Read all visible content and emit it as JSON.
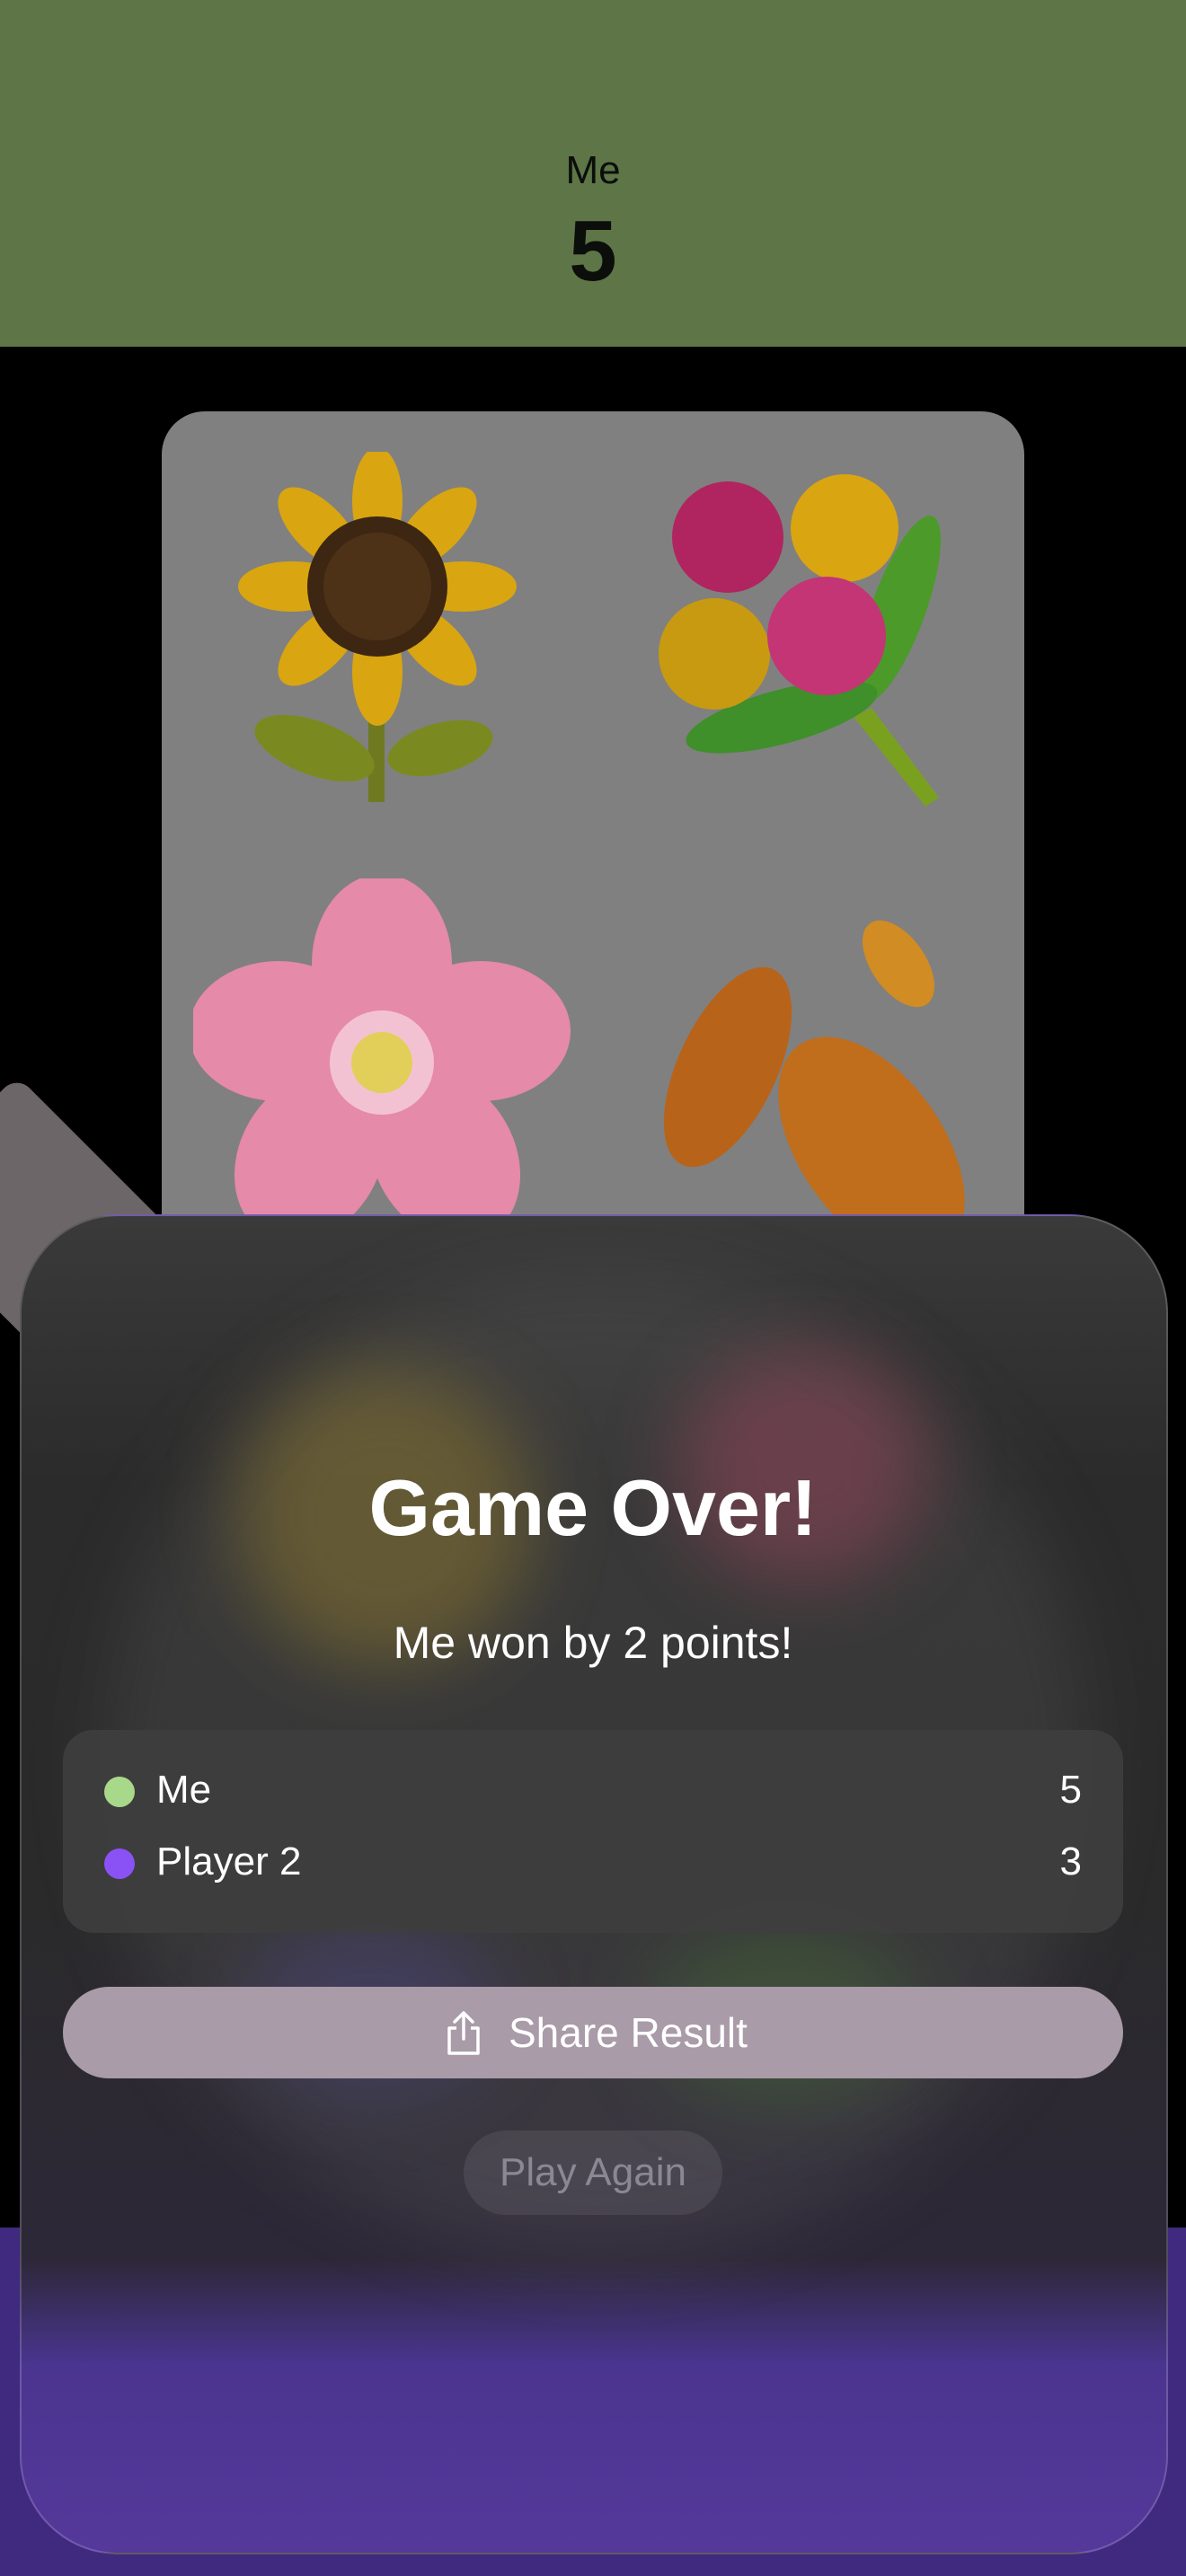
{
  "top_player": {
    "name": "Me",
    "score": "5"
  },
  "card": {
    "items": [
      {
        "icon": "sunflower-icon"
      },
      {
        "icon": "bouquet-icon"
      },
      {
        "icon": "cherry-blossom-icon"
      },
      {
        "icon": "fallen-leaves-icon"
      }
    ]
  },
  "game_over": {
    "title": "Game Over!",
    "subtitle": "Me won by 2 points!",
    "players": [
      {
        "name": "Me",
        "score": "5",
        "color": "#a8d98a"
      },
      {
        "name": "Player 2",
        "score": "3",
        "color": "#8a52f5"
      }
    ],
    "share_label": "Share Result",
    "share_icon": "share-icon",
    "play_again_label": "Play Again"
  },
  "colors": {
    "top_panel": "#5e7547",
    "bottom_panel": "#3f2a7f",
    "share_button": "#a99ba8"
  }
}
